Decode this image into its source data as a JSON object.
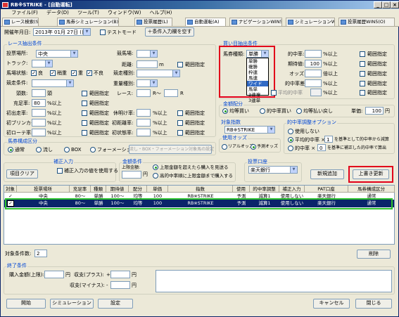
{
  "title": "RB※STRIKE - [自動運転]",
  "menu": [
    "ファイル(F)",
    "データ(D)",
    "ツール(T)",
    "ウィンドウ(W)",
    "ヘルプ(H)"
  ],
  "tabs": [
    "レース検索(S)",
    "馬券シミュレーション(B)",
    "投票履歴(L)",
    "自動運転(A)",
    "ナビゲーションWIN5(N)",
    "シミュレーションWIN5(M)",
    "投票履歴WIN5(O)"
  ],
  "top": {
    "date_label": "開催年月日:",
    "date_value": "2013年 01月 27日 (日)",
    "test_mode": "テストモード",
    "add_condition": "条件入力欄を空す"
  },
  "race_filter": {
    "title": "レース抽出条件",
    "venue_label": "投票場所:",
    "venue_value": "中央",
    "competition_label": "競馬場:",
    "track_label": "トラック:",
    "distance_label": "距離:",
    "distance_unit": "m",
    "range_spec": "範囲指定",
    "condition_label": "馬場状態:",
    "cond_good": "良",
    "cond_slightly": "稍重",
    "cond_heavy": "重",
    "cond_bad": "不良",
    "race_type_label": "競走種別:",
    "race_class_label": "競走条件:",
    "weight_label": "重量種別:",
    "head_label": "頭数:",
    "head_unit": "頭",
    "race_label": "レース:",
    "race_r1": "R〜",
    "race_r2": "R",
    "fill_label": "充足率:",
    "fill_value": "80",
    "pct_or_more": "%以上",
    "first_exec_label": "初出走率:",
    "rest_label": "休明け率:",
    "first_blinker_label": "初ブリンカー率:",
    "first_distance_label": "初距離率:",
    "first_class_label": "初ローテ率:",
    "first_status_label": "初状態率:"
  },
  "bet_filter": {
    "title": "買い目抽出条件",
    "bet_type_label": "馬券種類:",
    "bet_type_value": "単勝",
    "hit_rate_label": "的中率:",
    "pct_or_more": "%以上",
    "range_spec": "範囲指定",
    "expected_label": "期待値:",
    "expected_value": "100",
    "odds_label": "オッズ:",
    "odds_unit": "倍以上",
    "hit_diff_label": "的中率差:",
    "avg_hit_label": "平均的中率",
    "dropdown_items": [
      "単勝",
      "複勝",
      "枠連",
      "馬連",
      "ワイド",
      "馬単",
      "3連複",
      "3連単"
    ],
    "dropdown_selected": 4
  },
  "money": {
    "title": "金額配分",
    "opt1": "均等買い",
    "opt2": "的中率買い",
    "opt3": "均等払い戻し",
    "unit_label": "単価:",
    "unit_value": "100",
    "unit_yen": "円"
  },
  "target_indicator": {
    "title": "対象指数",
    "value": "RB※STRIKE",
    "odds_title": "使用オッズ",
    "realtime": "リアルオッズ",
    "forecast": "予測オッズ"
  },
  "hit_option": {
    "title": "的中率調整オプション",
    "opt1": "使用しない",
    "opt2": "平均的中率 ×",
    "opt2_val": "1",
    "opt2_tail": "を基準として的中率から減算",
    "opt3": "的中率 ×",
    "opt3_val": "0",
    "opt3_tail": "を基準に補正した的中率で算出"
  },
  "horse_format": {
    "title": "馬券構成区分",
    "opt1": "通常",
    "opt2": "流し",
    "opt3": "BOX",
    "opt4": "フォーメーション",
    "flow_btn": "流し・BOX・フォーメーション対象馬の設定"
  },
  "correction": {
    "title": "補正入力",
    "clear": "項目クリア",
    "check": "補正入力の値を使用する"
  },
  "amount": {
    "title": "金額条件",
    "limit_label": "上限金額:",
    "limit_unit": "円",
    "opt1": "上限金額を超えたら購入を見送る",
    "opt2": "高的中率順に上限金額まで購入する"
  },
  "account": {
    "title": "投票口座",
    "value": "楽天銀行",
    "new_btn": "新規追加",
    "overwrite_btn": "上書き更新"
  },
  "grid": {
    "headers": [
      "対象",
      "投票場所",
      "充足率",
      "種類",
      "期待値",
      "配分",
      "単価",
      "指数",
      "使用",
      "的中率調整",
      "補正入力",
      "PAT口座",
      "馬券構成区分"
    ],
    "rows": [
      [
        "✓",
        "中央",
        "80〜",
        "単勝",
        "100〜",
        "均等",
        "100",
        "RB※STRIKE",
        "予測",
        "減算1",
        "使用しない",
        "楽天銀行",
        "通常"
      ],
      [
        "✓",
        "中央",
        "80〜",
        "単勝",
        "100〜",
        "均等",
        "100",
        "RB※STRIKE",
        "予測",
        "減算1",
        "使用しない",
        "楽天銀行",
        "通常"
      ]
    ]
  },
  "count": {
    "label": "対象条件数:",
    "value": "2",
    "delete_btn": "削除"
  },
  "end": {
    "title": "終了条件",
    "buy_label": "購入金額(上限):",
    "yen": "円",
    "profit_plus": "収支(プラス):",
    "profit_minus": "収支(マイナス):",
    "plus_sign": "+",
    "minus_sign": "-"
  },
  "bottom": {
    "start": "開始",
    "simulation": "シミュレーション",
    "settings": "設定",
    "cancel": "キャンセル",
    "close": "閉じる"
  }
}
